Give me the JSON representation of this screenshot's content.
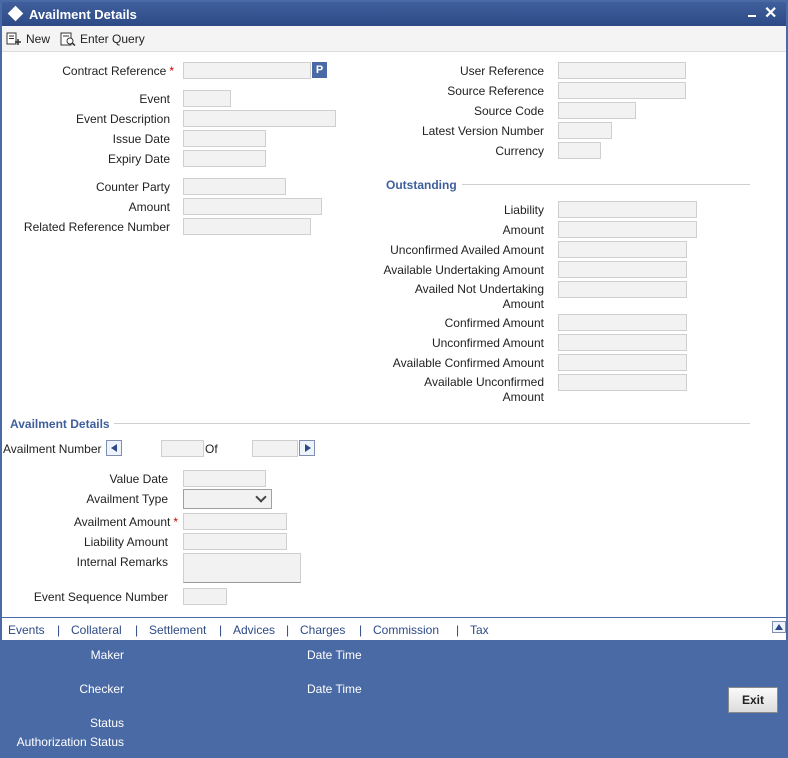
{
  "window": {
    "title": "Availment Details"
  },
  "toolbar": {
    "new_label": "New",
    "enter_query_label": "Enter Query"
  },
  "left": {
    "contract_reference": {
      "label": "Contract Reference",
      "required": "*",
      "lov_button": "P"
    },
    "event": "Event",
    "event_description": "Event Description",
    "issue_date": "Issue Date",
    "expiry_date": "Expiry Date",
    "counter_party": "Counter Party",
    "amount": "Amount",
    "related_reference_number": "Related Reference Number"
  },
  "right": {
    "user_reference": "User Reference",
    "source_reference": "Source Reference",
    "source_code": "Source Code",
    "latest_version_number": "Latest Version Number",
    "currency": "Currency"
  },
  "outstanding": {
    "title": "Outstanding",
    "liability": "Liability",
    "amount": "Amount",
    "unconfirmed_availed_amount": "Unconfirmed Availed Amount",
    "available_undertaking_amount": "Available Undertaking Amount",
    "availed_not_undertaking_amount": "Availed Not Undertaking Amount",
    "confirmed_amount": "Confirmed Amount",
    "unconfirmed_amount": "Unconfirmed Amount",
    "available_confirmed_amount": "Available Confirmed Amount",
    "available_unconfirmed_amount": "Available Unconfirmed Amount"
  },
  "availment": {
    "title": "Availment Details",
    "availment_number": "Availment Number",
    "of": "Of",
    "value_date": "Value Date",
    "availment_type": "Availment Type",
    "availment_amount": "Availment Amount",
    "required": "*",
    "liability_amount": "Liability Amount",
    "internal_remarks": "Internal Remarks",
    "event_sequence_number": "Event Sequence Number"
  },
  "tabs": [
    {
      "label": "Events"
    },
    {
      "label": "Collateral"
    },
    {
      "label": "Settlement"
    },
    {
      "label": "Advices"
    },
    {
      "label": "Charges"
    },
    {
      "label": "Commission"
    },
    {
      "label": "Tax"
    }
  ],
  "tab_separator": "|",
  "footer": {
    "maker": "Maker",
    "date_time_1": "Date Time",
    "checker": "Checker",
    "date_time_2": "Date Time",
    "status": "Status",
    "authorization_status": "Authorization Status",
    "exit_label": "Exit"
  },
  "colors": {
    "title_bar": "#2d4a86",
    "footer": "#4a6aa5",
    "accent_text": "#3f5f9c",
    "required": "#cc0000"
  },
  "icons": [
    "diamond-icon",
    "minimize-icon",
    "close-icon",
    "new-icon",
    "enter-query-icon",
    "chevron-down-icon",
    "previous-icon",
    "next-icon",
    "scroll-up-icon"
  ]
}
